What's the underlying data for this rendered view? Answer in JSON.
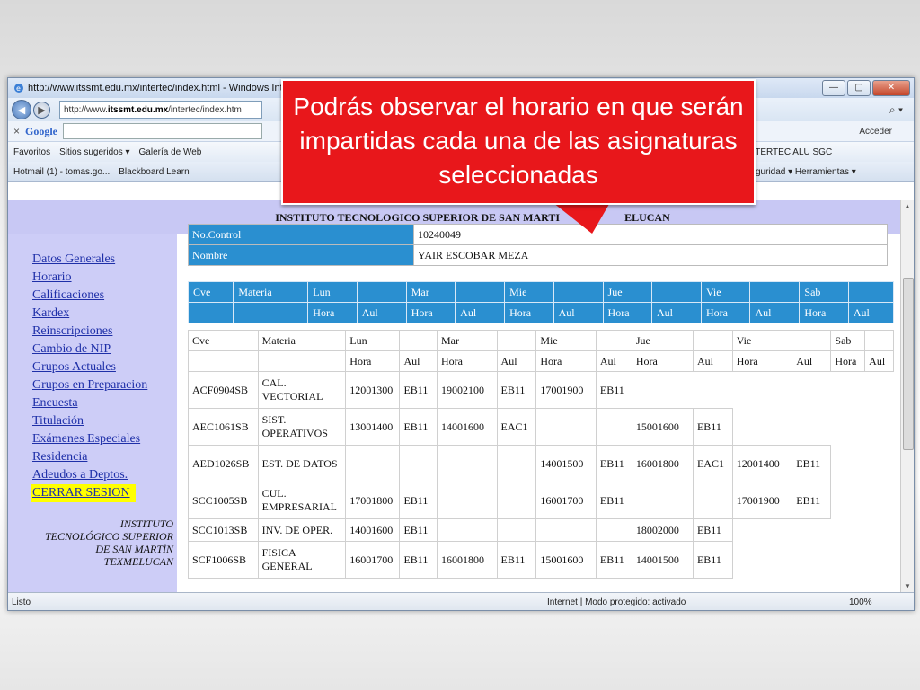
{
  "window": {
    "title": "http://www.itssmt.edu.mx/intertec/index.html - Windows Inte",
    "controls": {
      "minimize": "—",
      "maximize": "▢",
      "close": "✕"
    }
  },
  "address_bar": {
    "url_prefix": "http://www.",
    "url_host": "itssmt.edu.mx",
    "url_path": "/intertec/index.htm",
    "search_icon": "⌕ ▾"
  },
  "google_bar": {
    "close": "×",
    "logo": "Google",
    "signin": "Acceder"
  },
  "favorites_bar": {
    "favorites": "Favoritos",
    "suggested": "Sitios sugeridos ▾",
    "gallery": "Galería de Web",
    "right_items": "NTERTEC ALU   SGC"
  },
  "tabs_bar": {
    "tab1": "Hotmail (1) - tomas.go...",
    "tab2": "Blackboard Learn",
    "tools": "guridad ▾   Herramientas ▾"
  },
  "page": {
    "header": "INSTITUTO TECNOLOGICO SUPERIOR DE SAN MARTI",
    "header_tail": "ELUCAN",
    "menu": [
      "Datos Generales",
      "Horario",
      "Calificaciones",
      "Kardex",
      "Reinscripciones",
      "Cambio de NIP",
      "Grupos Actuales",
      "Grupos en Preparacion",
      "Encuesta",
      "Titulación",
      "Exámenes Especiales",
      "Residencia",
      "Adeudos a Deptos."
    ],
    "logout": "CERRAR SESION",
    "institution_text": "INSTITUTO\nTECNOLÓGICO SUPERIOR\nDE SAN MARTÍN\nTEXMELUCAN",
    "student": {
      "control_label": "No.Control",
      "control_value": "10240049",
      "name_label": "Nombre",
      "name_value": "YAIR ESCOBAR MEZA"
    },
    "blue_header_row1": [
      "Cve",
      "Materia",
      "Lun",
      "",
      "Mar",
      "",
      "Mie",
      "",
      "Jue",
      "",
      "Vie",
      "",
      "Sab",
      ""
    ],
    "blue_header_row2": [
      "",
      "",
      "Hora",
      "Aul",
      "Hora",
      "Aul",
      "Hora",
      "Aul",
      "Hora",
      "Aul",
      "Hora",
      "Aul",
      "Hora",
      "Aul"
    ],
    "schedule_header_row1": [
      "Cve",
      "Materia",
      "Lun",
      "",
      "Mar",
      "",
      "Mie",
      "",
      "Jue",
      "",
      "Vie",
      "",
      "Sab",
      ""
    ],
    "schedule_header_row2": [
      "",
      "",
      "Hora",
      "Aul",
      "Hora",
      "Aul",
      "Hora",
      "Aul",
      "Hora",
      "Aul",
      "Hora",
      "Aul",
      "Hora",
      "Aul"
    ],
    "schedule_rows": [
      [
        "ACF0904SB",
        "CAL. VECTORIAL",
        "12001300",
        "EB11",
        "19002100",
        "EB11",
        "17001900",
        "EB11",
        "",
        "",
        "",
        "",
        "",
        ""
      ],
      [
        "AEC1061SB",
        "SIST. OPERATIVOS",
        "13001400",
        "EB11",
        "14001600",
        "EAC1",
        "",
        "",
        "15001600",
        "EB11",
        "",
        "",
        "",
        ""
      ],
      [
        "AED1026SB",
        "EST. DE DATOS",
        "",
        "",
        "",
        "",
        "14001500",
        "EB11",
        "16001800",
        "EAC1",
        "12001400",
        "EB11",
        "",
        ""
      ],
      [
        "SCC1005SB",
        "CUL. EMPRESARIAL",
        "17001800",
        "EB11",
        "",
        "",
        "16001700",
        "EB11",
        "",
        "",
        "17001900",
        "EB11",
        "",
        ""
      ],
      [
        "SCC1013SB",
        "INV. DE OPER.",
        "14001600",
        "EB11",
        "",
        "",
        "",
        "",
        "18002000",
        "EB11",
        "",
        "",
        "",
        ""
      ],
      [
        "SCF1006SB",
        "FISICA GENERAL",
        "16001700",
        "EB11",
        "16001800",
        "EB11",
        "15001600",
        "EB11",
        "14001500",
        "EB11",
        "",
        "",
        "",
        ""
      ]
    ]
  },
  "status_bar": {
    "left": "Listo",
    "zone": "Internet | Modo protegido: activado",
    "zoom": "100%"
  },
  "callout": {
    "text": "Podrás observar el horario en que serán impartidas cada una de las asignaturas seleccionadas",
    "color": "#e8171b"
  }
}
